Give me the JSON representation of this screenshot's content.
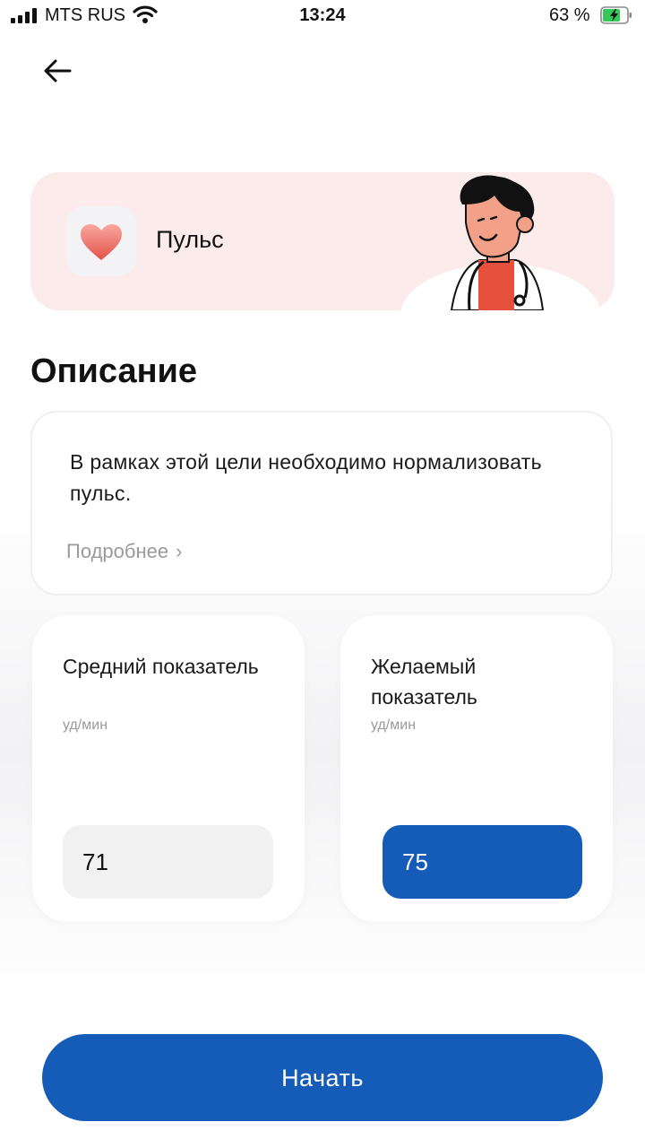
{
  "status_bar": {
    "carrier": "MTS RUS",
    "time": "13:24",
    "battery_percent": "63 %",
    "icons": [
      "signal-icon",
      "wifi-icon",
      "battery-charging-icon"
    ]
  },
  "nav": {
    "back_icon": "arrow-left-icon"
  },
  "hero": {
    "title": "Пульс",
    "icon": "heart-icon",
    "illustration": "doctor-illustration",
    "background_color": "#fcebeb"
  },
  "description": {
    "heading": "Описание",
    "text": "В рамках этой цели необходимо нормализовать пульс.",
    "more_link": "Подробнее",
    "more_icon": "chevron-right-icon"
  },
  "metrics": [
    {
      "label": "Средний показатель",
      "unit": "уд/мин",
      "value": "71"
    },
    {
      "label": "Желаемый показатель",
      "unit": "уд/мин",
      "value": "75"
    }
  ],
  "actions": {
    "start_label": "Начать"
  },
  "colors": {
    "accent": "#145cb8",
    "hero_bg": "#fcebeb"
  }
}
